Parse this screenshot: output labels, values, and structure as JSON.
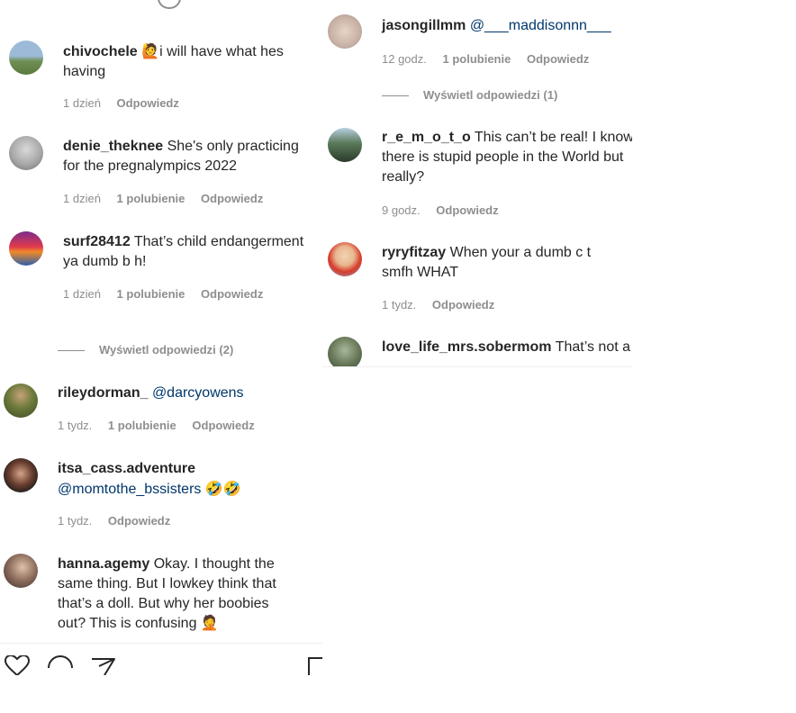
{
  "left_comments": [
    {
      "user": "chivochele",
      "emoji": "🙋",
      "text": "i will have what hes having",
      "time": "1 dzień",
      "likes": "",
      "reply": "Odpowiedz"
    },
    {
      "user": "denie_theknee",
      "emoji": "",
      "text": "She's only practicing for the pregnalympics 2022",
      "time": "1 dzień",
      "likes": "1 polubienie",
      "reply": "Odpowiedz"
    },
    {
      "user": "surf28412",
      "emoji": "",
      "text": "That’s child endangerment ya dumb b    h!",
      "time": "1 dzień",
      "likes": "1 polubienie",
      "reply": "Odpowiedz"
    },
    {
      "user": "rileydorman_",
      "mention": "@darcyowens",
      "text": "",
      "time": "1 tydz.",
      "likes": "1 polubienie",
      "reply": "Odpowiedz"
    },
    {
      "user": "itsa_cass.adventure",
      "mention": "@momtothe_bssisters",
      "text": "🤣🤣",
      "time": "1 tydz.",
      "likes": "",
      "reply": "Odpowiedz"
    },
    {
      "user": "hanna.agemy",
      "text": "Okay. I thought the same thing. But I lowkey think that that’s a doll. But why her boobies out? This is confusing 🤦"
    }
  ],
  "left_view_replies": "Wyświetl odpowiedzi (2)",
  "right_comments": [
    {
      "user": "jasongillmm",
      "mention": "@___maddisonnn___",
      "text": "",
      "time": "12 godz.",
      "likes": "1 polubienie",
      "reply": "Odpowiedz"
    },
    {
      "user": "r_e_m_o_t_o",
      "text": "This can’t be real! I know there is stupid people in the World but really?",
      "time": "9 godz.",
      "likes": "",
      "reply": "Odpowiedz"
    },
    {
      "user": "ryryfitzay",
      "text": "When your a dumb c     t smfh WHAT",
      "time": "1 tydz.",
      "likes": "",
      "reply": "Odpowiedz"
    },
    {
      "user": "love_life_mrs.sobermom",
      "text": "That’s not a"
    }
  ],
  "right_view_replies": "Wyświetl odpowiedzi (1)",
  "icons": [
    "heart-icon",
    "comment-icon",
    "share-icon",
    "bookmark-icon"
  ]
}
